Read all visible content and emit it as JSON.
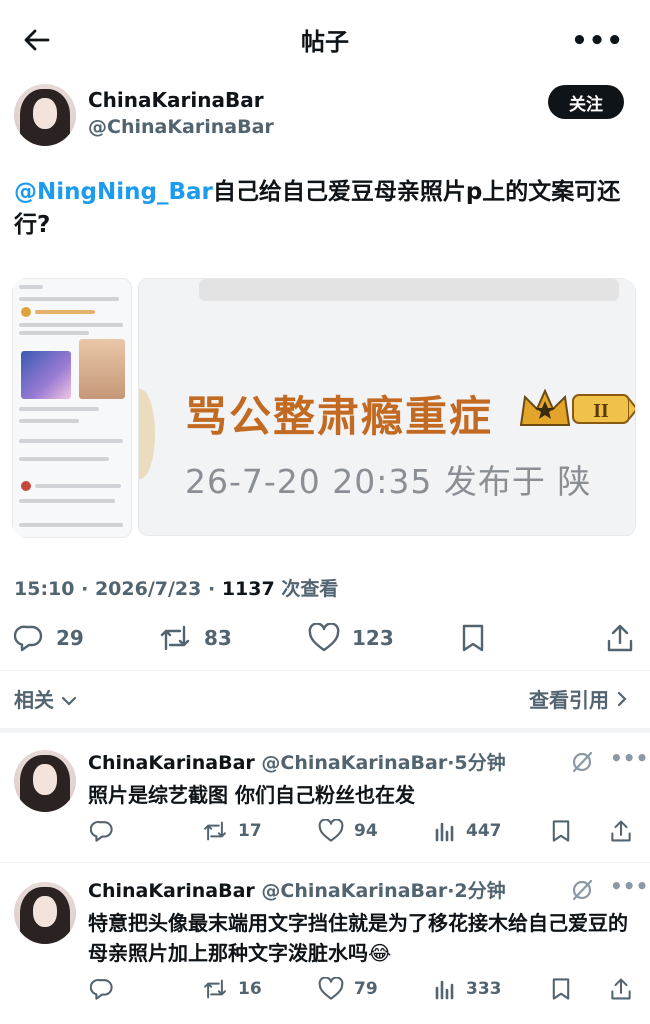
{
  "header": {
    "title": "帖子"
  },
  "post": {
    "author_name": "ChinaKarinaBar",
    "author_handle": "@ChinaKarinaBar",
    "follow_label": "关注",
    "mention": "@NingNing_Bar",
    "text": "自己给自己爱豆母亲照片p上的文案可还行?",
    "media": {
      "overlay_title": "骂公整肃瘾重症",
      "overlay_date": "26-7-20 20:35 发布于 陕",
      "badge_level": "II"
    },
    "time": "15:10",
    "date": "2026/7/23",
    "views": "1137",
    "views_label": "次查看",
    "replies": "29",
    "reposts": "83",
    "likes": "123"
  },
  "related_label": "相关",
  "quotes_label": "查看引用",
  "replies": [
    {
      "name": "ChinaKarinaBar",
      "handle": "@ChinaKarinaBar",
      "age": "5分钟",
      "text": "照片是综艺截图 你们自己粉丝也在发",
      "reposts": "17",
      "likes": "94",
      "views": "447"
    },
    {
      "name": "ChinaKarinaBar",
      "handle": "@ChinaKarinaBar",
      "age": "2分钟",
      "text": "特意把头像最末端用文字挡住就是为了移花接木给自己爱豆的母亲照片加上那种文字泼脏水吗😂",
      "reposts": "16",
      "likes": "79",
      "views": "333"
    }
  ],
  "colors": {
    "text": "#0f1419",
    "secondary": "#536471",
    "mention": "#1d9bf0",
    "overlay_title": "#c36a22"
  },
  "icons": [
    "back-arrow-icon",
    "more-icon",
    "reply-icon",
    "repost-icon",
    "like-icon",
    "bookmark-icon",
    "share-icon",
    "views-icon",
    "grok-icon",
    "chevron-down-icon",
    "chevron-right-icon"
  ]
}
